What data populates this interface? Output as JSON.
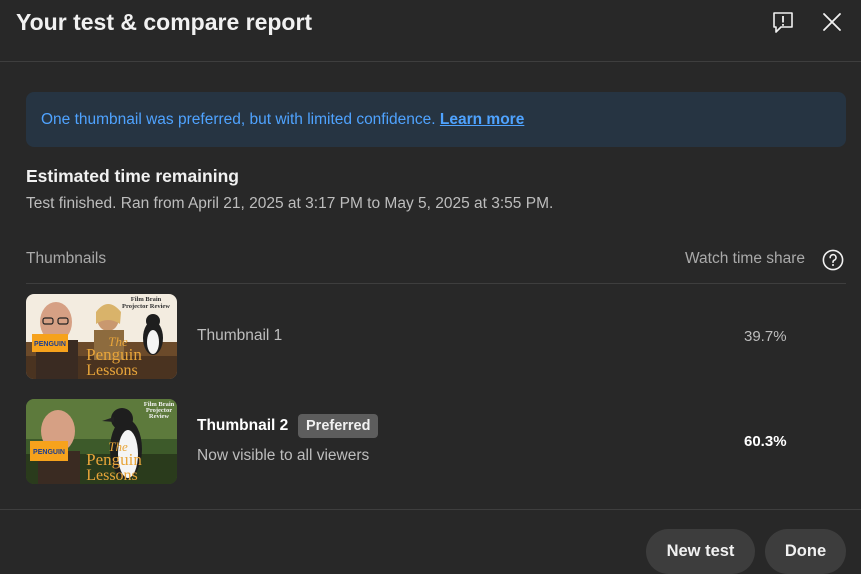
{
  "dialog": {
    "title": "Your test & compare report"
  },
  "icons": {
    "feedback": "feedback-icon",
    "close": "close-icon",
    "help": "help-circle-icon"
  },
  "banner": {
    "message": "One thumbnail was preferred, but with limited confidence.",
    "link": "Learn more"
  },
  "estimate": {
    "title": "Estimated time remaining",
    "subtitle": "Test finished. Ran from April 21, 2025 at 3:17 PM to May 5, 2025 at 3:55 PM."
  },
  "table": {
    "col_thumbnails": "Thumbnails",
    "col_share": "Watch time share",
    "rows": [
      {
        "label": "Thumbnail 1",
        "share": "39.7%",
        "thumb_text": {
          "top_line1": "Film Brain",
          "top_line2": "Projector Review",
          "word1": "The",
          "word2": "Penguin",
          "word3": "Lessons",
          "box": "PENGUIN"
        }
      },
      {
        "label": "Thumbnail 2",
        "badge": "Preferred",
        "note": "Now visible to all viewers",
        "share": "60.3%",
        "thumb_text": {
          "top_line1": "Film Brain",
          "top_line2": "Projector",
          "top_line3": "Review",
          "word1": "The",
          "word2": "Penguin",
          "word3": "Lessons",
          "box": "PENGUIN"
        }
      }
    ]
  },
  "footer": {
    "new_test": "New test",
    "done": "Done"
  },
  "colors": {
    "background": "#282828",
    "banner_bg": "#263442",
    "link_blue": "#4fa3ff",
    "button_bg": "#3d3d3d",
    "badge_bg": "#5d5d5d"
  }
}
